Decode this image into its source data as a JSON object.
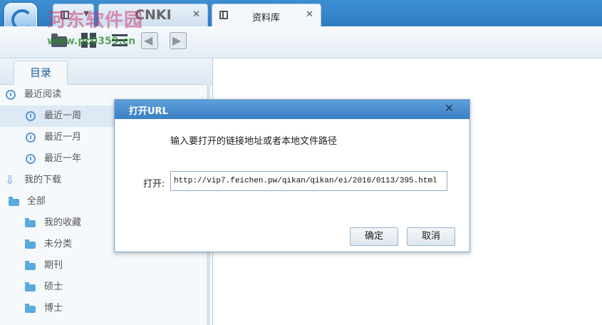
{
  "tabs": [
    {
      "label": "",
      "icon": "book-icon"
    },
    {
      "label": "CNKI",
      "icon": "book-icon"
    },
    {
      "label": "资料库",
      "icon": "book-icon"
    }
  ],
  "watermark": {
    "line1": "河东软件园",
    "line2": "www.pc0359.cn"
  },
  "sidebar": {
    "tab_label": "目录",
    "items": [
      {
        "label": "最近阅读",
        "icon": "clock-icon"
      },
      {
        "label": "最近一周",
        "icon": "clock-icon"
      },
      {
        "label": "最近一月",
        "icon": "clock-icon"
      },
      {
        "label": "最近一年",
        "icon": "clock-icon"
      },
      {
        "label": "我的下载",
        "icon": "download-icon"
      },
      {
        "label": "全部",
        "icon": "folder-open-icon"
      },
      {
        "label": "我的收藏",
        "icon": "folder-icon"
      },
      {
        "label": "未分类",
        "icon": "folder-icon"
      },
      {
        "label": "期刊",
        "icon": "folder-icon"
      },
      {
        "label": "硕士",
        "icon": "folder-icon"
      },
      {
        "label": "博士",
        "icon": "folder-icon"
      }
    ]
  },
  "dialog": {
    "title": "打开URL",
    "prompt": "输入要打开的链接地址或者本地文件路径",
    "field_label": "打开:",
    "url_value": "http://vip7.feichen.pw/qikan/qikan/ei/2016/0113/395.html",
    "ok_label": "确定",
    "cancel_label": "取消"
  },
  "colors": {
    "accent": "#3a7fc3",
    "selected_row": "#dde9f5"
  }
}
